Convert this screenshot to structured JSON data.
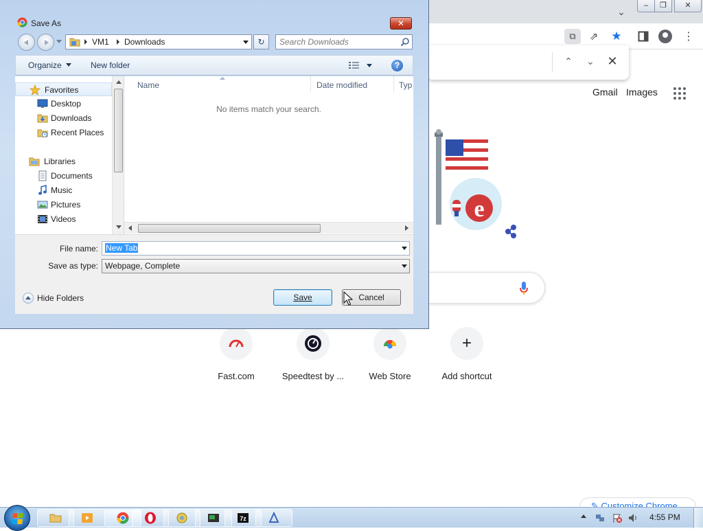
{
  "chrome": {
    "links": {
      "gmail": "Gmail",
      "images": "Images"
    },
    "shortcuts": [
      {
        "label": "Fast.com"
      },
      {
        "label": "Speedtest by ..."
      },
      {
        "label": "Web Store"
      },
      {
        "label": "Add shortcut",
        "icon": "+"
      }
    ],
    "customize_label": "✎ Customize Chrome",
    "find_bar": {
      "up_icon": "⌃",
      "down_icon": "⌄",
      "close_icon": "✕"
    },
    "window_controls": {
      "minimize": "–",
      "maximize": "❐",
      "close": "✕"
    },
    "tab_search_icon": "⌄"
  },
  "dialog": {
    "title": "Save As",
    "close_icon": "✕",
    "breadcrumb": [
      "VM1",
      "Downloads"
    ],
    "refresh_icon": "↻",
    "search_placeholder": "Search Downloads",
    "toolbar": {
      "organize": "Organize",
      "new_folder": "New folder",
      "help": "?"
    },
    "nav": {
      "favorites": "Favorites",
      "desktop": "Desktop",
      "downloads": "Downloads",
      "recent_places": "Recent Places",
      "libraries": "Libraries",
      "documents": "Documents",
      "music": "Music",
      "pictures": "Pictures",
      "videos": "Videos"
    },
    "columns": {
      "name": "Name",
      "date_modified": "Date modified",
      "type": "Typ"
    },
    "empty_message": "No items match your search.",
    "file_name_label": "File name:",
    "file_name_value": "New Tab",
    "save_as_type_label": "Save as type:",
    "save_as_type_value": "Webpage, Complete",
    "hide_folders": "Hide Folders",
    "save_button": "Save",
    "cancel_button": "Cancel"
  },
  "taskbar": {
    "clock": "4:55 PM"
  },
  "colors": {
    "chrome_accent": "#1a73e8",
    "dialog_frame": "#c3d7ee",
    "selection": "#3399ff"
  }
}
